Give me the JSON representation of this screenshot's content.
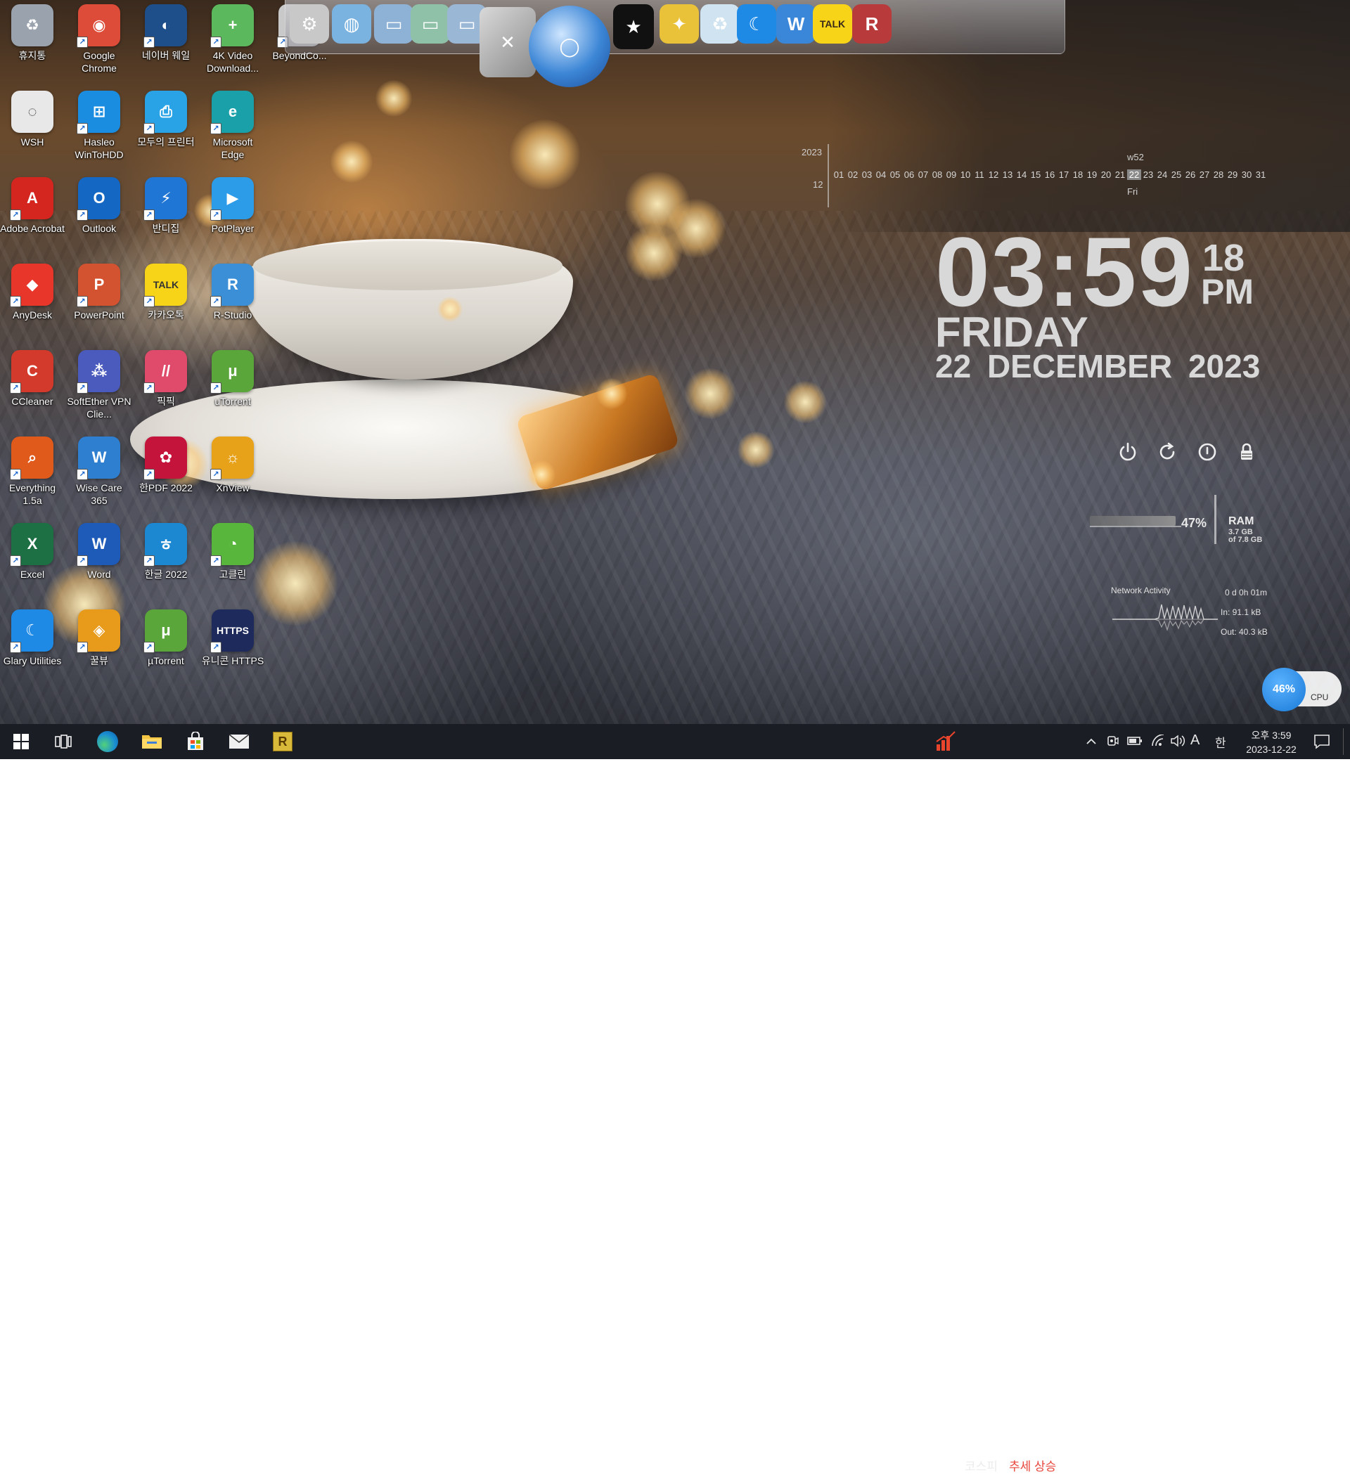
{
  "desktop_icons": [
    {
      "label": "휴지통",
      "icon": "recycle-bin-icon",
      "color": "#9aa3ad",
      "glyph": "♻"
    },
    {
      "label": "Google Chrome",
      "icon": "chrome-icon",
      "color": "#dd4b39",
      "glyph": "◉"
    },
    {
      "label": "네이버 웨일",
      "icon": "whale-icon",
      "color": "#1e4f8a",
      "glyph": "◐"
    },
    {
      "label": "4K Video Download...",
      "icon": "4k-video-downloader-icon",
      "color": "#5cb85c",
      "glyph": "+"
    },
    {
      "label": "BeyondCo...",
      "icon": "beyond-compare-icon",
      "color": "#c9c9c9",
      "glyph": "◎"
    },
    {
      "label": "WSH",
      "icon": "wsh-file-icon",
      "color": "#e8e8e8",
      "glyph": "◌"
    },
    {
      "label": "Hasleo WinToHDD",
      "icon": "wintohdd-icon",
      "color": "#1a8de0",
      "glyph": "⊞"
    },
    {
      "label": "모두의 프린터",
      "icon": "printer-icon",
      "color": "#29a3e5",
      "glyph": "⎙"
    },
    {
      "label": "Microsoft Edge",
      "icon": "edge-icon",
      "color": "#1aa0a8",
      "glyph": "e"
    },
    {
      "label": "Adobe Acrobat",
      "icon": "acrobat-icon",
      "color": "#d4261f",
      "glyph": "A"
    },
    {
      "label": "Outlook",
      "icon": "outlook-icon",
      "color": "#1467c2",
      "glyph": "O"
    },
    {
      "label": "반디집",
      "icon": "bandizip-icon",
      "color": "#1f76d4",
      "glyph": "⚡"
    },
    {
      "label": "PotPlayer",
      "icon": "potplayer-icon",
      "color": "#2c9be8",
      "glyph": "▶"
    },
    {
      "label": "AnyDesk",
      "icon": "anydesk-icon",
      "color": "#e8362b",
      "glyph": "◆"
    },
    {
      "label": "PowerPoint",
      "icon": "powerpoint-icon",
      "color": "#d35230",
      "glyph": "P"
    },
    {
      "label": "카카오톡",
      "icon": "kakaotalk-icon",
      "color": "#f7d417",
      "glyph": "TALK"
    },
    {
      "label": "R-Studio",
      "icon": "r-studio-icon",
      "color": "#3a8fd6",
      "glyph": "R"
    },
    {
      "label": "CCleaner",
      "icon": "ccleaner-icon",
      "color": "#d33a2c",
      "glyph": "C"
    },
    {
      "label": "SoftEther VPN Clie...",
      "icon": "softether-vpn-icon",
      "color": "#4a5bbd",
      "glyph": "⁂"
    },
    {
      "label": "픽픽",
      "icon": "picpick-icon",
      "color": "#e04b6b",
      "glyph": "//"
    },
    {
      "label": "uTorrent",
      "icon": "utorrent-icon",
      "color": "#5aa63a",
      "glyph": "μ"
    },
    {
      "label": "Everything 1.5a",
      "icon": "everything-search-icon",
      "color": "#e05a1c",
      "glyph": "⌕"
    },
    {
      "label": "Wise Care 365",
      "icon": "wise-care-icon",
      "color": "#2f7fd1",
      "glyph": "W"
    },
    {
      "label": "한PDF 2022",
      "icon": "hanpdf-icon",
      "color": "#c4143c",
      "glyph": "✿"
    },
    {
      "label": "XnView",
      "icon": "xnview-icon",
      "color": "#e8a21a",
      "glyph": "☼"
    },
    {
      "label": "Excel",
      "icon": "excel-icon",
      "color": "#1d7044",
      "glyph": "X"
    },
    {
      "label": "Word",
      "icon": "word-icon",
      "color": "#1e5bb8",
      "glyph": "W"
    },
    {
      "label": "한글 2022",
      "icon": "hangul-icon",
      "color": "#1c88d2",
      "glyph": "ㅎ"
    },
    {
      "label": "고클린",
      "icon": "goclean-icon",
      "color": "#58b63c",
      "glyph": "◔"
    },
    {
      "label": "Glary Utilities",
      "icon": "glary-utilities-icon",
      "color": "#1e8ae6",
      "glyph": "☾"
    },
    {
      "label": "꿀뷰",
      "icon": "honeyview-icon",
      "color": "#e89b1a",
      "glyph": "◈"
    },
    {
      "label": "µTorrent",
      "icon": "mu-torrent-icon",
      "color": "#5aa63a",
      "glyph": "μ"
    },
    {
      "label": "유니콘 HTTPS",
      "icon": "unicorn-https-icon",
      "color": "#1e2a5c",
      "glyph": "HTTPS"
    }
  ],
  "dock": [
    {
      "name": "dock-settings-icon",
      "color": "#c8c8c8",
      "glyph": "⚙"
    },
    {
      "name": "dock-network-icon",
      "color": "#7bb3e0",
      "glyph": "◍"
    },
    {
      "name": "dock-folder-icon",
      "color": "#8db2d6",
      "glyph": "▭"
    },
    {
      "name": "dock-folder-green-icon",
      "color": "#8fc0a8",
      "glyph": "▭"
    },
    {
      "name": "dock-folder-open-icon",
      "color": "#9bb7d6",
      "glyph": "▭"
    },
    {
      "name": "dock-tools-icon",
      "color": "#b9b9b9",
      "glyph": "✕"
    },
    {
      "name": "dock-globe-icon",
      "color": "#3c86d6",
      "glyph": "◯"
    },
    {
      "name": "dock-tshirt-icon",
      "color": "#111111",
      "glyph": "★"
    },
    {
      "name": "dock-wand-icon",
      "color": "#e9c23a",
      "glyph": "✦"
    },
    {
      "name": "dock-trash-icon",
      "color": "#cfe3f0",
      "glyph": "♻"
    },
    {
      "name": "dock-glary-icon",
      "color": "#1e8ae6",
      "glyph": "☾"
    },
    {
      "name": "dock-wise-icon",
      "color": "#3a86d8",
      "glyph": "W"
    },
    {
      "name": "dock-kakaotalk-icon",
      "color": "#f7d417",
      "glyph": "TALK"
    },
    {
      "name": "dock-r-studio-icon",
      "color": "#b83a3a",
      "glyph": "R"
    }
  ],
  "calendar": {
    "year": "2023",
    "month": "12",
    "week": "w52",
    "days": [
      "01",
      "02",
      "03",
      "04",
      "05",
      "06",
      "07",
      "08",
      "09",
      "10",
      "11",
      "12",
      "13",
      "14",
      "15",
      "16",
      "17",
      "18",
      "19",
      "20",
      "21",
      "22",
      "23",
      "24",
      "25",
      "26",
      "27",
      "28",
      "29",
      "30",
      "31"
    ],
    "selected_day": "22",
    "dow": "Fri"
  },
  "clock": {
    "time": "03:59",
    "seconds": "18",
    "ampm": "PM",
    "day": "FRIDAY",
    "date": "22 DECEMBER  2023"
  },
  "system_buttons": [
    {
      "name": "power-icon",
      "glyph": "⏻"
    },
    {
      "name": "restart-icon",
      "glyph": "⟳"
    },
    {
      "name": "sleep-icon",
      "glyph": "ⓘ"
    },
    {
      "name": "lock-icon",
      "glyph": "🔒"
    }
  ],
  "ram": {
    "percent": "47%",
    "fill_percent": 47,
    "title": "RAM",
    "used": "3.7 GB",
    "total": "of 7.8 GB"
  },
  "network": {
    "title": "Network Activity",
    "uptime": "0 d 0h 01m",
    "in": "In: 91.1 kB",
    "out": "Out: 40.3 kB"
  },
  "cpu": {
    "percent": "46%",
    "label": "CPU",
    "accent": "#1979d6"
  },
  "taskbar": {
    "items": [
      {
        "name": "start-button",
        "glyph": "⊞"
      },
      {
        "name": "task-view-icon",
        "glyph": "⧉"
      },
      {
        "name": "edge-taskbar-icon",
        "glyph": "e"
      },
      {
        "name": "file-explorer-icon",
        "glyph": "▭"
      },
      {
        "name": "store-icon",
        "glyph": "⊞"
      },
      {
        "name": "mail-icon",
        "glyph": "✉"
      },
      {
        "name": "r-studio-taskbar-icon",
        "glyph": "R"
      }
    ],
    "kospi_label": "코스피",
    "kospi_trend": "추세 상승",
    "ime_mode": "A",
    "ime_lang": "한",
    "clock_time": "오후 3:59",
    "clock_date": "2023-12-22"
  }
}
